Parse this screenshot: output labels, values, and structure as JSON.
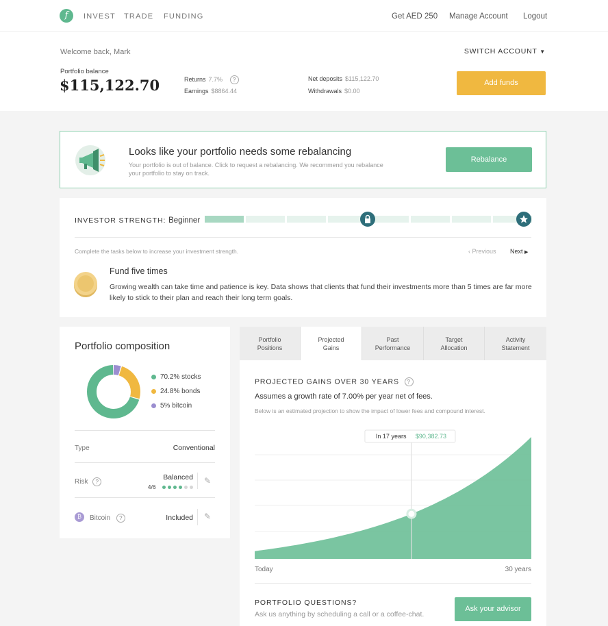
{
  "nav": {
    "logo": "f",
    "links": [
      "INVEST",
      "TRADE",
      "FUNDING"
    ],
    "right": [
      "Get AED 250",
      "Manage Account",
      "Logout"
    ]
  },
  "header": {
    "welcome": "Welcome back, Mark",
    "switch_account": "SWITCH ACCOUNT",
    "portfolio_balance_label": "Portfolio balance",
    "portfolio_balance": "$115,122.70",
    "returns_label": "Returns",
    "returns_value": "7.7%",
    "earnings_label": "Earnings",
    "earnings_value": "$8864.44",
    "net_deposits_label": "Net deposits",
    "net_deposits_value": "$115,122.70",
    "withdrawals_label": "Withdrawals",
    "withdrawals_value": "$0.00",
    "add_funds": "Add funds"
  },
  "rebalance": {
    "title": "Looks like your portfolio needs some rebalancing",
    "description": "Your portfolio is out of balance. Click to request a rebalancing. We recommend you rebalance your portfolio to stay on track.",
    "button": "Rebalance"
  },
  "strength": {
    "label": "INVESTOR STRENGTH:",
    "level": "Beginner",
    "progress_fraction": 0.125,
    "hint": "Complete the tasks below to increase your investment strength.",
    "previous": "Previous",
    "next": "Next",
    "task_title": "Fund five times",
    "task_description": "Growing wealth can take time and patience is key. Data shows that clients that fund their investments more than 5 times are far more likely to stick to their plan and reach their long term goals."
  },
  "composition": {
    "title": "Portfolio composition",
    "slices": [
      {
        "label": "70.2% stocks",
        "value": 70.2,
        "color": "#5fb88f"
      },
      {
        "label": "24.8% bonds",
        "value": 24.8,
        "color": "#f0b840"
      },
      {
        "label": "5% bitcoin",
        "value": 5,
        "color": "#9b8ed0"
      }
    ],
    "type_label": "Type",
    "type_value": "Conventional",
    "risk_label": "Risk",
    "risk_value": "Balanced",
    "risk_score": "4/6",
    "risk_level": 4,
    "risk_max": 6,
    "bitcoin_label": "Bitcoin",
    "bitcoin_value": "Included",
    "bitcoin_icon": "bitcoin-icon"
  },
  "tabs": [
    {
      "line1": "Portfolio",
      "line2": "Positions"
    },
    {
      "line1": "Projected",
      "line2": "Gains"
    },
    {
      "line1": "Past",
      "line2": "Performance"
    },
    {
      "line1": "Target",
      "line2": "Allocation"
    },
    {
      "line1": "Activity",
      "line2": "Statement"
    }
  ],
  "active_tab": 1,
  "projection": {
    "title": "PROJECTED GAINS OVER 30 YEARS",
    "subtitle": "Assumes a growth rate of 7.00% per year net of fees.",
    "note": "Below is an estimated projection to show the impact of lower fees and compound interest.",
    "tooltip_label": "In 17 years",
    "tooltip_value": "$90,382.73",
    "x_start": "Today",
    "x_end": "30 years",
    "questions_title": "PORTFOLIO QUESTIONS?",
    "questions_desc": "Ask us anything by scheduling a call or a coffee-chat.",
    "advisor_button": "Ask your advisor"
  },
  "chart_data": {
    "type": "area",
    "x": [
      0,
      17,
      30
    ],
    "xlabel": "",
    "ylabel": "",
    "growth_rate": 0.07,
    "highlight": {
      "x": 17,
      "y": 90382.73
    },
    "color": "#6cbf97"
  }
}
